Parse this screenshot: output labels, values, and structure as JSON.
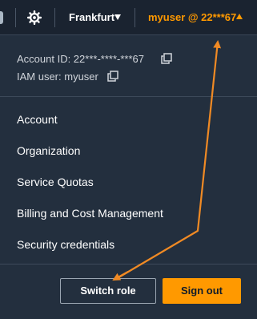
{
  "topbar": {
    "region_label": "Frankfurt",
    "user_menu_label": "myuser @ 22***67",
    "icons": [
      "gear-icon",
      "caret-down-icon",
      "caret-up-icon"
    ]
  },
  "account_panel": {
    "account_id_text": "Account ID: 22***-****-***67",
    "iam_user_text": "IAM user: myuser",
    "icons": [
      "copy-icon"
    ]
  },
  "menu": {
    "items": [
      "Account",
      "Organization",
      "Service Quotas",
      "Billing and Cost Management",
      "Security credentials"
    ]
  },
  "actions": {
    "switch_role_label": "Switch role",
    "sign_out_label": "Sign out"
  },
  "colors": {
    "panel_background": "#232f3e",
    "topbar_background": "#1a2330",
    "accent_orange": "#ff9900",
    "annotation_arrow": "#f08a24"
  }
}
